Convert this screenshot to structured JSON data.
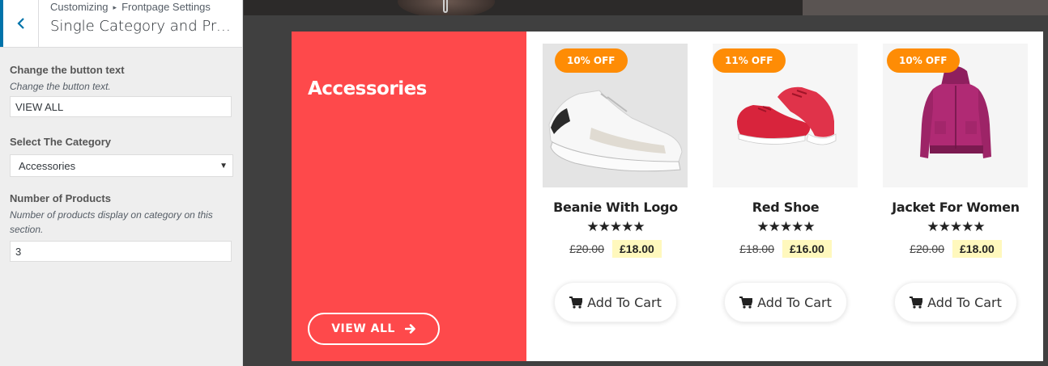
{
  "sidebar": {
    "breadcrumb_root": "Customizing",
    "breadcrumb_separator": "▸",
    "breadcrumb_section": "Frontpage Settings",
    "title": "Single Category and Pro…",
    "button_text": {
      "label": "Change the button text",
      "description": "Change the button text.",
      "value": "VIEW ALL"
    },
    "category": {
      "label": "Select The Category",
      "selected": "Accessories",
      "caret": "▼"
    },
    "num_products": {
      "label": "Number of Products",
      "description": "Number of products display on category on this section.",
      "value": "3"
    }
  },
  "preview": {
    "category_title": "Accessories",
    "view_all_label": "VIEW ALL",
    "colors": {
      "category_bg": "#fe494b",
      "badge_bg": "#fe8c05",
      "price_highlight": "#fff8bd",
      "accent_blue": "#0073aa"
    },
    "products": [
      {
        "name": "Beanie With Logo",
        "badge": "10% OFF",
        "stars": "★★★★★",
        "rating": 5,
        "old_price": "£20.00",
        "new_price": "£18.00",
        "cart_label": "Add To Cart",
        "image": "white-sneaker"
      },
      {
        "name": "Red Shoe",
        "badge": "11% OFF",
        "stars": "★★★★★",
        "rating": 5,
        "old_price": "£18.00",
        "new_price": "£16.00",
        "cart_label": "Add To Cart",
        "image": "red-shoe"
      },
      {
        "name": "Jacket For Women",
        "badge": "10% OFF",
        "stars": "★★★★★",
        "rating": 5,
        "old_price": "£20.00",
        "new_price": "£18.00",
        "cart_label": "Add To Cart",
        "image": "magenta-hoodie"
      }
    ]
  },
  "icons": {
    "back": "chevron-left-icon",
    "view_all": "arrow-right-icon",
    "cart": "cart-icon"
  }
}
